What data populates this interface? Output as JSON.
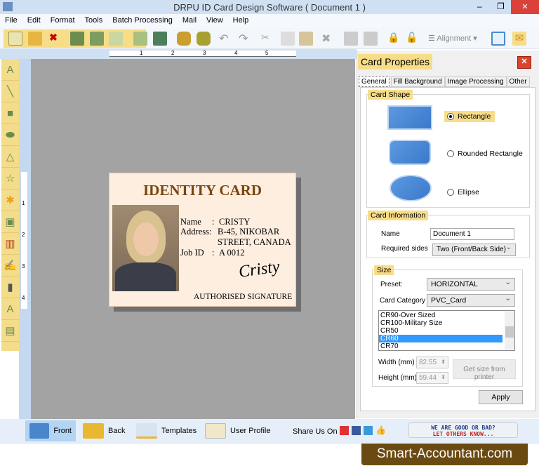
{
  "window": {
    "title": "DRPU ID Card Design Software ( Document 1 )",
    "minimize": "–",
    "maximize": "❐",
    "close": "✕"
  },
  "menu": [
    "File",
    "Edit",
    "Format",
    "Tools",
    "Batch Processing",
    "Mail",
    "View",
    "Help"
  ],
  "toolbar": {
    "alignment_label": "Alignment"
  },
  "ruler": {
    "h_ticks": [
      "1",
      "2",
      "3",
      "4",
      "5"
    ],
    "v_ticks": [
      "1",
      "2",
      "3",
      "4"
    ]
  },
  "card": {
    "title": "IDENTITY CARD",
    "name_label": "Name",
    "name_value": "CRISTY",
    "address_label": "Address:",
    "address_line1": "B-45, NIKOBAR",
    "address_line2": "STREET, CANADA",
    "jobid_label": "Job ID",
    "jobid_value": "A 0012",
    "sep": ":",
    "signature": "Cristy",
    "signature_label": "AUTHORISED SIGNATURE"
  },
  "panel": {
    "title": "Card Properties",
    "tabs": [
      "General",
      "Fill Background",
      "Image Processing",
      "Other"
    ],
    "card_shape": {
      "label": "Card Shape",
      "options": [
        "Rectangle",
        "Rounded Rectangle",
        "Ellipse"
      ],
      "selected": "Rectangle"
    },
    "card_info": {
      "label": "Card Information",
      "name_label": "Name",
      "name_value": "Document 1",
      "sides_label": "Required sides",
      "sides_value": "Two (Front/Back Side)"
    },
    "size": {
      "label": "Size",
      "preset_label": "Preset:",
      "preset_value": "HORIZONTAL",
      "category_label": "Card Category",
      "category_value": "PVC_Card",
      "list": [
        "CR90-Over Sized",
        "CR100-Military Size",
        "CR50",
        "CR60",
        "CR70"
      ],
      "selected": "CR60",
      "width_label": "Width  (mm)",
      "width_value": "82.55",
      "height_label": "Height  (mm)",
      "height_value": "59.44",
      "printer_button": "Get size from printer"
    },
    "apply": "Apply"
  },
  "bottom": {
    "front": "Front",
    "back": "Back",
    "templates": "Templates",
    "user_profile": "User Profile",
    "share": "Share Us On :",
    "feedback1": "WE ARE GOOD OR BAD?",
    "feedback2": "LET OTHERS KNOW..."
  },
  "watermark": "Smart-Accountant.com"
}
